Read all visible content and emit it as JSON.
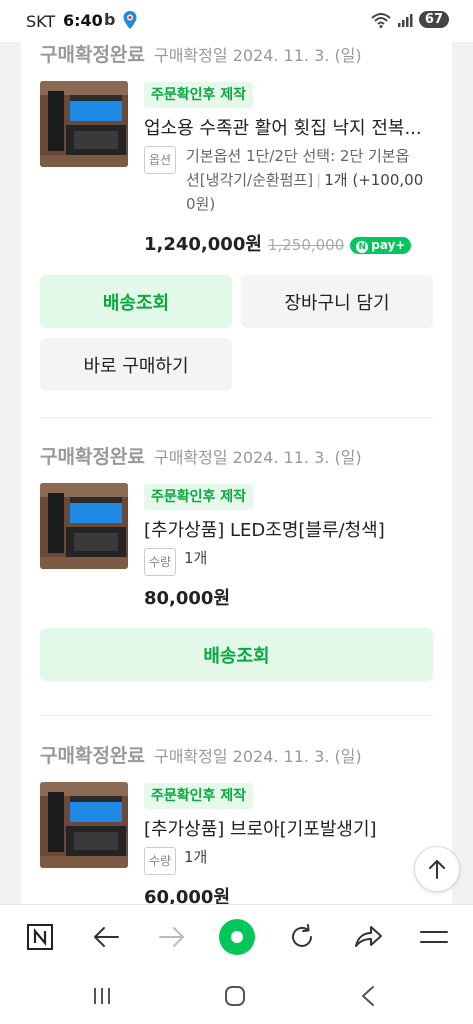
{
  "status_bar": {
    "carrier": "SKT",
    "time": "6:40",
    "b_icon": "b",
    "battery": "67"
  },
  "orders": [
    {
      "status": "구매확정완료",
      "confirm_date": "구매확정일 2024. 11. 3. (일)",
      "badge": "주문확인후 제작",
      "name": "업소용 수족관 활어 횟집 낙지 전복...",
      "option_tag": "옵션",
      "option_line1": "기본옵션 1단/2단 선택: 2단 기본옵",
      "option_line2": "션[냉각기/순환펌프]",
      "option_qty": "1개 (+100,00",
      "option_line3": "0원)",
      "price": "1,240,000원",
      "original_price": "1,250,000",
      "npay_label": "pay+",
      "buttons": {
        "track": "배송조회",
        "cart": "장바구니 담기",
        "buy": "바로 구매하기"
      }
    },
    {
      "status": "구매확정완료",
      "confirm_date": "구매확정일 2024. 11. 3. (일)",
      "badge": "주문확인후 제작",
      "name": "[추가상품] LED조명[블루/청색]",
      "qty_tag": "수량",
      "qty": "1개",
      "price": "80,000원",
      "buttons": {
        "track": "배송조회"
      }
    },
    {
      "status": "구매확정완료",
      "confirm_date": "구매확정일 2024. 11. 3. (일)",
      "badge": "주문확인후 제작",
      "name": "[추가상품] 브로아[기포발생기]",
      "qty_tag": "수량",
      "qty": "1개",
      "price": "60,000원"
    }
  ],
  "colors": {
    "accent_green": "#0aa83f",
    "button_green_bg": "#e2f8e8",
    "npay_green": "#03c75a"
  }
}
